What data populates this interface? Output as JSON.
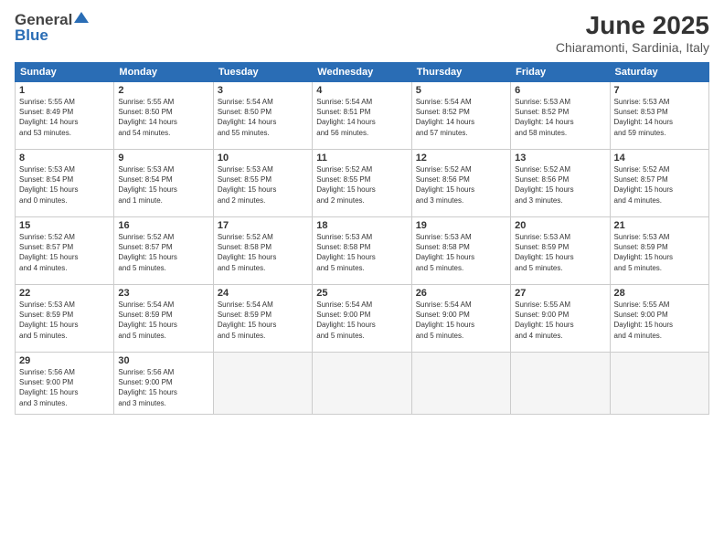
{
  "header": {
    "logo_line1": "General",
    "logo_line2": "Blue",
    "month": "June 2025",
    "location": "Chiaramonti, Sardinia, Italy"
  },
  "weekdays": [
    "Sunday",
    "Monday",
    "Tuesday",
    "Wednesday",
    "Thursday",
    "Friday",
    "Saturday"
  ],
  "weeks": [
    [
      {
        "day": "1",
        "info": "Sunrise: 5:55 AM\nSunset: 8:49 PM\nDaylight: 14 hours\nand 53 minutes."
      },
      {
        "day": "2",
        "info": "Sunrise: 5:55 AM\nSunset: 8:50 PM\nDaylight: 14 hours\nand 54 minutes."
      },
      {
        "day": "3",
        "info": "Sunrise: 5:54 AM\nSunset: 8:50 PM\nDaylight: 14 hours\nand 55 minutes."
      },
      {
        "day": "4",
        "info": "Sunrise: 5:54 AM\nSunset: 8:51 PM\nDaylight: 14 hours\nand 56 minutes."
      },
      {
        "day": "5",
        "info": "Sunrise: 5:54 AM\nSunset: 8:52 PM\nDaylight: 14 hours\nand 57 minutes."
      },
      {
        "day": "6",
        "info": "Sunrise: 5:53 AM\nSunset: 8:52 PM\nDaylight: 14 hours\nand 58 minutes."
      },
      {
        "day": "7",
        "info": "Sunrise: 5:53 AM\nSunset: 8:53 PM\nDaylight: 14 hours\nand 59 minutes."
      }
    ],
    [
      {
        "day": "8",
        "info": "Sunrise: 5:53 AM\nSunset: 8:54 PM\nDaylight: 15 hours\nand 0 minutes."
      },
      {
        "day": "9",
        "info": "Sunrise: 5:53 AM\nSunset: 8:54 PM\nDaylight: 15 hours\nand 1 minute."
      },
      {
        "day": "10",
        "info": "Sunrise: 5:53 AM\nSunset: 8:55 PM\nDaylight: 15 hours\nand 2 minutes."
      },
      {
        "day": "11",
        "info": "Sunrise: 5:52 AM\nSunset: 8:55 PM\nDaylight: 15 hours\nand 2 minutes."
      },
      {
        "day": "12",
        "info": "Sunrise: 5:52 AM\nSunset: 8:56 PM\nDaylight: 15 hours\nand 3 minutes."
      },
      {
        "day": "13",
        "info": "Sunrise: 5:52 AM\nSunset: 8:56 PM\nDaylight: 15 hours\nand 3 minutes."
      },
      {
        "day": "14",
        "info": "Sunrise: 5:52 AM\nSunset: 8:57 PM\nDaylight: 15 hours\nand 4 minutes."
      }
    ],
    [
      {
        "day": "15",
        "info": "Sunrise: 5:52 AM\nSunset: 8:57 PM\nDaylight: 15 hours\nand 4 minutes."
      },
      {
        "day": "16",
        "info": "Sunrise: 5:52 AM\nSunset: 8:57 PM\nDaylight: 15 hours\nand 5 minutes."
      },
      {
        "day": "17",
        "info": "Sunrise: 5:52 AM\nSunset: 8:58 PM\nDaylight: 15 hours\nand 5 minutes."
      },
      {
        "day": "18",
        "info": "Sunrise: 5:53 AM\nSunset: 8:58 PM\nDaylight: 15 hours\nand 5 minutes."
      },
      {
        "day": "19",
        "info": "Sunrise: 5:53 AM\nSunset: 8:58 PM\nDaylight: 15 hours\nand 5 minutes."
      },
      {
        "day": "20",
        "info": "Sunrise: 5:53 AM\nSunset: 8:59 PM\nDaylight: 15 hours\nand 5 minutes."
      },
      {
        "day": "21",
        "info": "Sunrise: 5:53 AM\nSunset: 8:59 PM\nDaylight: 15 hours\nand 5 minutes."
      }
    ],
    [
      {
        "day": "22",
        "info": "Sunrise: 5:53 AM\nSunset: 8:59 PM\nDaylight: 15 hours\nand 5 minutes."
      },
      {
        "day": "23",
        "info": "Sunrise: 5:54 AM\nSunset: 8:59 PM\nDaylight: 15 hours\nand 5 minutes."
      },
      {
        "day": "24",
        "info": "Sunrise: 5:54 AM\nSunset: 8:59 PM\nDaylight: 15 hours\nand 5 minutes."
      },
      {
        "day": "25",
        "info": "Sunrise: 5:54 AM\nSunset: 9:00 PM\nDaylight: 15 hours\nand 5 minutes."
      },
      {
        "day": "26",
        "info": "Sunrise: 5:54 AM\nSunset: 9:00 PM\nDaylight: 15 hours\nand 5 minutes."
      },
      {
        "day": "27",
        "info": "Sunrise: 5:55 AM\nSunset: 9:00 PM\nDaylight: 15 hours\nand 4 minutes."
      },
      {
        "day": "28",
        "info": "Sunrise: 5:55 AM\nSunset: 9:00 PM\nDaylight: 15 hours\nand 4 minutes."
      }
    ],
    [
      {
        "day": "29",
        "info": "Sunrise: 5:56 AM\nSunset: 9:00 PM\nDaylight: 15 hours\nand 3 minutes."
      },
      {
        "day": "30",
        "info": "Sunrise: 5:56 AM\nSunset: 9:00 PM\nDaylight: 15 hours\nand 3 minutes."
      },
      {
        "day": "",
        "info": ""
      },
      {
        "day": "",
        "info": ""
      },
      {
        "day": "",
        "info": ""
      },
      {
        "day": "",
        "info": ""
      },
      {
        "day": "",
        "info": ""
      }
    ]
  ]
}
